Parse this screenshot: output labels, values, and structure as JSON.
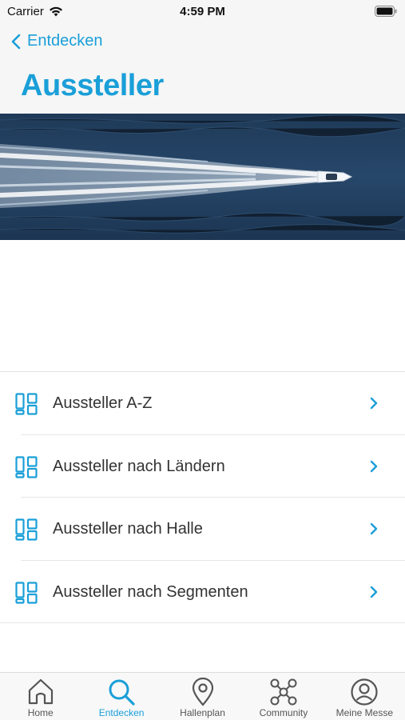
{
  "status_bar": {
    "carrier": "Carrier",
    "time": "4:59 PM"
  },
  "header": {
    "back_label": "Entdecken",
    "title": "Aussteller"
  },
  "menu": {
    "items": [
      {
        "label": "Aussteller A-Z",
        "icon": "grid-layout-icon"
      },
      {
        "label": "Aussteller nach Ländern",
        "icon": "grid-layout-icon"
      },
      {
        "label": "Aussteller nach Halle",
        "icon": "grid-layout-icon"
      },
      {
        "label": "Aussteller nach Segmenten",
        "icon": "grid-layout-icon"
      }
    ]
  },
  "tab_bar": {
    "items": [
      {
        "label": "Home",
        "icon": "house-icon",
        "active": false
      },
      {
        "label": "Entdecken",
        "icon": "search-icon",
        "active": true
      },
      {
        "label": "Hallenplan",
        "icon": "map-pin-icon",
        "active": false
      },
      {
        "label": "Community",
        "icon": "network-icon",
        "active": false
      },
      {
        "label": "Meine Messe",
        "icon": "user-circle-icon",
        "active": false
      }
    ]
  },
  "colors": {
    "accent": "#1a9fd8",
    "header_bg": "#f6f6f6",
    "text": "#333333"
  }
}
